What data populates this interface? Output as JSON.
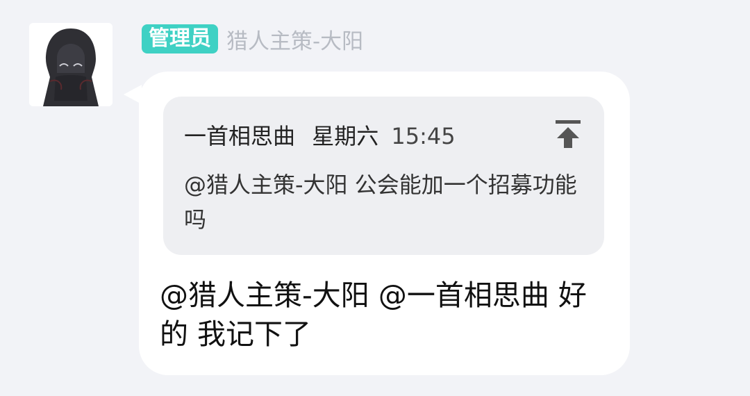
{
  "sender": {
    "badge": "管理员",
    "name": "猎人主策-大阳"
  },
  "quote": {
    "author": "一首相思曲",
    "day": "星期六",
    "time": "15:45",
    "text": "@猎人主策-大阳 公会能加一个招募功能吗",
    "collapse_icon": "arrow-up-to-top-icon"
  },
  "message": {
    "text": "@猎人主策-大阳 @一首相思曲 好的 我记下了"
  },
  "colors": {
    "background": "#f2f3f7",
    "badge": "#3fd1c4",
    "bubble": "#ffffff",
    "quote_bg": "#eeeff2"
  }
}
